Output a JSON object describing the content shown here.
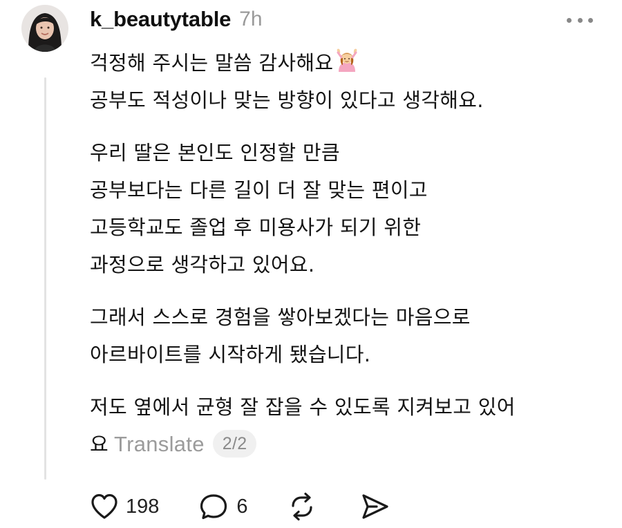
{
  "post": {
    "username": "k_beautytable",
    "time": "7h",
    "paragraphs": [
      [
        "걱정해 주시는 말씀 감사해요",
        "공부도 적성이나 맞는 방향이 있다고 생각해요."
      ],
      [
        "우리 딸은 본인도 인정할 만큼",
        "공부보다는 다른 길이 더 잘 맞는 편이고",
        "고등학교도 졸업 후 미용사가 되기 위한",
        "과정으로 생각하고 있어요."
      ],
      [
        "그래서 스스로 경험을 쌓아보겠다는 마음으로",
        "아르바이트를 시작하게 됐습니다."
      ],
      [
        "저도 옆에서 균형 잘 잡을 수 있도록 지켜보고 있어",
        "요"
      ]
    ],
    "translate_label": "Translate",
    "page_indicator": "2/2"
  },
  "actions": {
    "likes": "198",
    "comments": "6"
  },
  "icons": {
    "more": "more-horizontal-icon",
    "emoji": "person-gesturing-ok-emoji",
    "like": "heart-icon",
    "comment": "comment-bubble-icon",
    "repost": "repost-icon",
    "share": "send-icon"
  },
  "colors": {
    "text": "#141414",
    "muted": "#9b9b9b",
    "thread_line": "#e3e3e3",
    "badge_bg": "#f0f0f0"
  }
}
